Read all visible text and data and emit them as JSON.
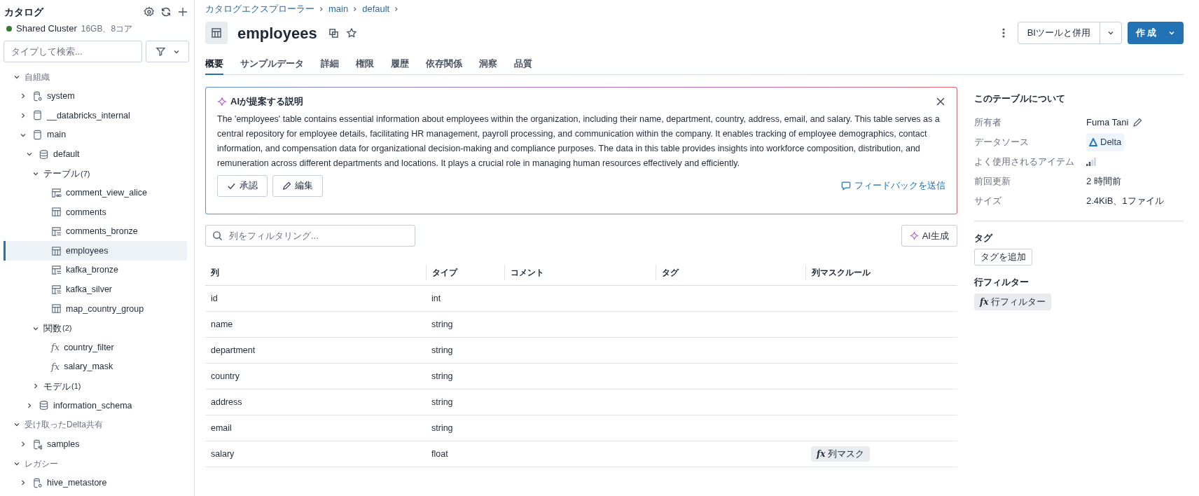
{
  "sidebar": {
    "title": "カタログ",
    "cluster": {
      "name": "Shared Cluster",
      "detail": "16GB、8コア",
      "color": "#2e7d32"
    },
    "search": {
      "placeholder": "タイプして検索..."
    },
    "tree": [
      {
        "kind": "section",
        "label": "自組織",
        "expanded": true,
        "selected": false,
        "children": [
          {
            "kind": "system-catalog",
            "label": "system",
            "expanded": false,
            "selected": false
          },
          {
            "kind": "catalog",
            "label": "__databricks_internal",
            "expanded": false,
            "selected": false
          },
          {
            "kind": "catalog",
            "label": "main",
            "expanded": true,
            "selected": false,
            "children": [
              {
                "kind": "schema",
                "label": "default",
                "expanded": true,
                "selected": false,
                "children": [
                  {
                    "kind": "group",
                    "label": "テーブル",
                    "count": "(7)",
                    "expanded": true,
                    "selected": false,
                    "children": [
                      {
                        "kind": "view",
                        "label": "comment_view_alice",
                        "selected": false
                      },
                      {
                        "kind": "table",
                        "label": "comments",
                        "selected": false
                      },
                      {
                        "kind": "stream",
                        "label": "comments_bronze",
                        "selected": false
                      },
                      {
                        "kind": "table",
                        "label": "employees",
                        "selected": true
                      },
                      {
                        "kind": "stream",
                        "label": "kafka_bronze",
                        "selected": false
                      },
                      {
                        "kind": "stream",
                        "label": "kafka_silver",
                        "selected": false
                      },
                      {
                        "kind": "table",
                        "label": "map_country_group",
                        "selected": false
                      }
                    ]
                  },
                  {
                    "kind": "group",
                    "label": "関数",
                    "count": "(2)",
                    "expanded": true,
                    "selected": false,
                    "children": [
                      {
                        "kind": "function",
                        "glyph": "fx",
                        "label": "country_filter",
                        "selected": false
                      },
                      {
                        "kind": "function",
                        "glyph": "fx",
                        "label": "salary_mask",
                        "selected": false
                      }
                    ]
                  },
                  {
                    "kind": "group",
                    "label": "モデル",
                    "count": "(1)",
                    "expanded": false,
                    "selected": false
                  }
                ]
              },
              {
                "kind": "schema",
                "label": "information_schema",
                "expanded": false,
                "selected": false
              }
            ]
          }
        ]
      },
      {
        "kind": "section",
        "label": "受け取ったDelta共有",
        "expanded": true,
        "selected": false,
        "children": [
          {
            "kind": "shared-catalog",
            "label": "samples",
            "expanded": false,
            "selected": false
          }
        ]
      },
      {
        "kind": "section",
        "label": "レガシー",
        "expanded": true,
        "selected": false,
        "children": [
          {
            "kind": "system-catalog",
            "label": "hive_metastore",
            "expanded": false,
            "selected": false
          }
        ]
      }
    ]
  },
  "breadcrumb": [
    "カタログエクスプローラー",
    "main",
    "default"
  ],
  "page_title": "employees",
  "actions": {
    "secondary": "BIツールと併用",
    "primary": "作成"
  },
  "tabs": [
    {
      "label": "概要",
      "selected": true
    },
    {
      "label": "サンプルデータ",
      "selected": false
    },
    {
      "label": "詳細",
      "selected": false
    },
    {
      "label": "権限",
      "selected": false
    },
    {
      "label": "履歴",
      "selected": false
    },
    {
      "label": "依存関係",
      "selected": false
    },
    {
      "label": "洞察",
      "selected": false
    },
    {
      "label": "品質",
      "selected": false
    }
  ],
  "ai_description": {
    "title": "AIが提案する説明",
    "text": "The 'employees' table contains essential information about employees within the organization, including their name, department, country, address, email, and salary. This table serves as a central repository for employee details, facilitating HR management, payroll processing, and communication within the company. It enables tracking of employee demographics, contact information, and compensation data for organizational decision-making and compliance purposes. The data in this table provides insights into workforce composition, distribution, and remuneration across different departments and locations. It plays a crucial role in managing human resources effectively and efficiently.",
    "accept": "承認",
    "edit": "編集",
    "feedback": "フィードバックを送信"
  },
  "column_filter": {
    "placeholder": "列をフィルタリング..."
  },
  "ai_generate": "AI生成",
  "table": {
    "columns": [
      "列",
      "タイプ",
      "コメント",
      "タグ",
      "列マスクルール"
    ],
    "rows": [
      {
        "name": "id",
        "type": "int"
      },
      {
        "name": "name",
        "type": "string"
      },
      {
        "name": "department",
        "type": "string"
      },
      {
        "name": "country",
        "type": "string"
      },
      {
        "name": "address",
        "type": "string"
      },
      {
        "name": "email",
        "type": "string"
      },
      {
        "name": "salary",
        "type": "float",
        "mask": {
          "glyph": "fx",
          "label": "列マスク"
        }
      }
    ]
  },
  "about": {
    "title": "このテーブルについて",
    "rows": [
      {
        "kind": "owner",
        "label": "所有者",
        "value": "Fuma Tani"
      },
      {
        "kind": "source",
        "label": "データソース",
        "value": "Delta"
      },
      {
        "kind": "popularity",
        "label": "よく使用されるアイテム"
      },
      {
        "kind": "text",
        "label": "前回更新",
        "value": "2 時間前"
      },
      {
        "kind": "text",
        "label": "サイズ",
        "value": "2.4KiB、1ファイル"
      }
    ]
  },
  "tags": {
    "title": "タグ",
    "button": "タグを追加"
  },
  "row_filter": {
    "title": "行フィルター",
    "glyph": "fx",
    "badge": "行フィルター"
  }
}
